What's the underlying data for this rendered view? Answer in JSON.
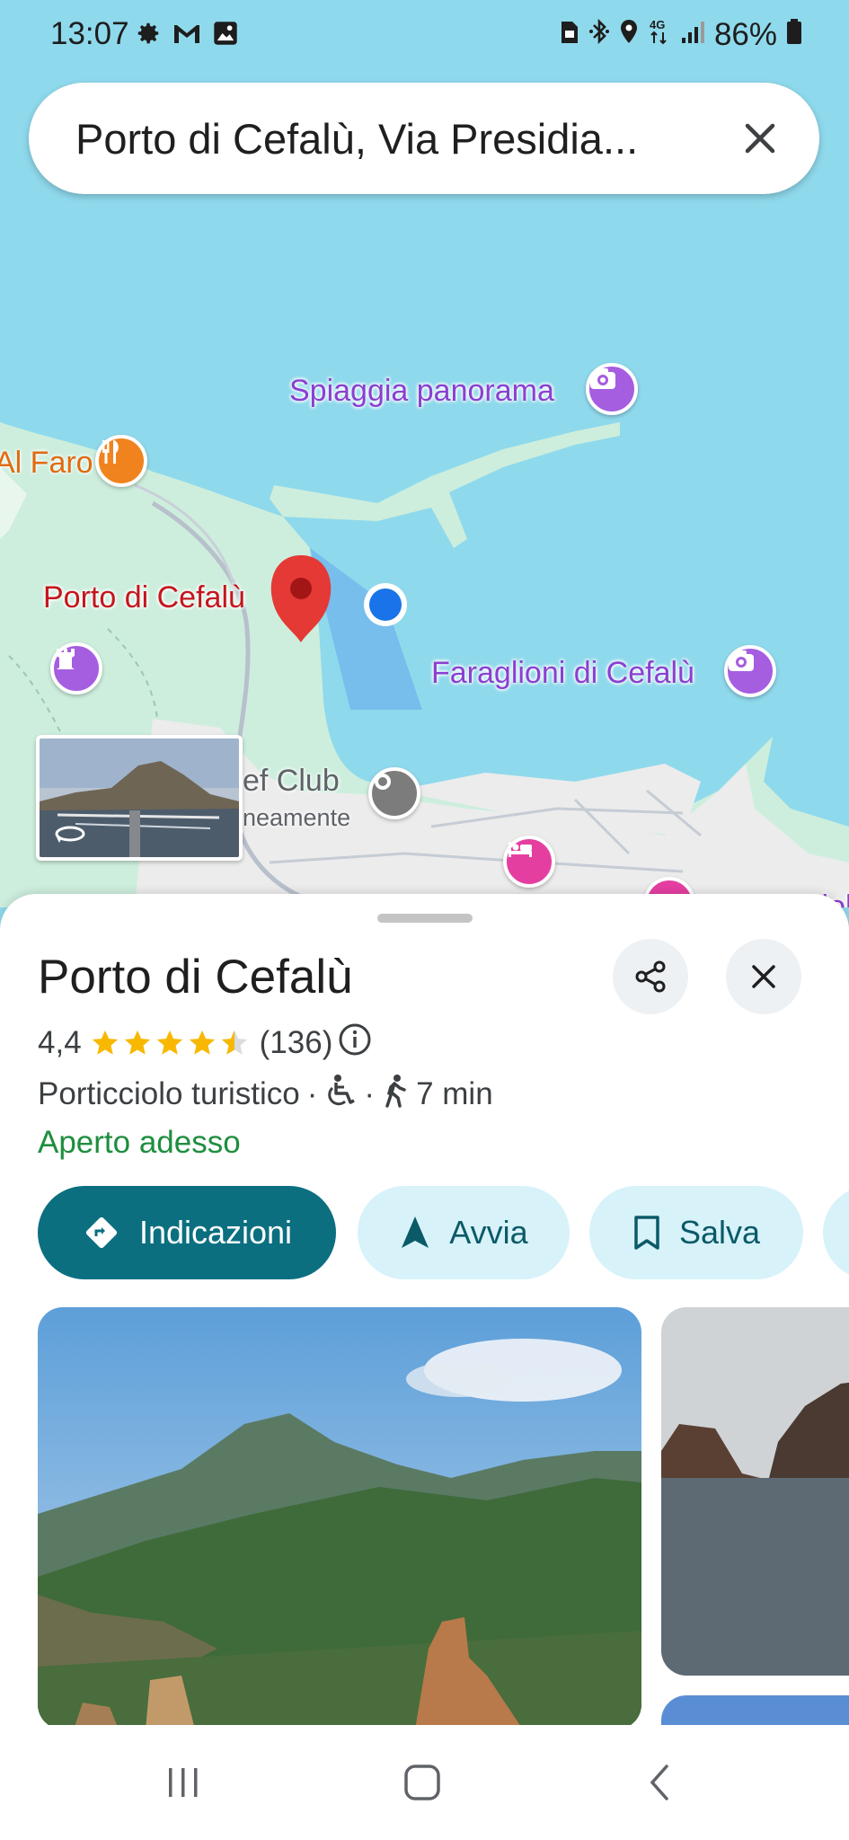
{
  "status_bar": {
    "time": "13:07",
    "left_icons": [
      "gear-icon",
      "gmail-icon",
      "gallery-icon"
    ],
    "right_icons": [
      "sim-icon",
      "bluetooth-icon",
      "location-icon",
      "network-4g-icon",
      "signal-icon"
    ],
    "battery": "86%"
  },
  "search": {
    "query": "Porto di Cefalù, Via Presidia..."
  },
  "map": {
    "labels": {
      "spiaggia": "Spiaggia panorama",
      "al_faro": "Al Faro",
      "porto": "Porto di Cefalù",
      "faraglioni": "Faraglioni di Cefalù",
      "club": "ef Club",
      "club_sub": "neamente",
      "edge": "Hiolu"
    },
    "colors": {
      "water": "#8fd9ec",
      "land": "#cdeedd",
      "urban": "#ececec",
      "marker": "#e53935",
      "location_dot": "#1a73e8"
    }
  },
  "place": {
    "name": "Porto di Cefalù",
    "rating": "4,4",
    "stars": 4.4,
    "reviews": "(136)",
    "category": "Porticciolo turistico",
    "separator": "·",
    "walk_time": "7 min",
    "status": "Aperto adesso"
  },
  "actions": {
    "directions": "Indicazioni",
    "start": "Avvia",
    "save": "Salva"
  },
  "nav": {
    "recents": "recents-icon",
    "home": "home-icon",
    "back": "back-icon"
  }
}
